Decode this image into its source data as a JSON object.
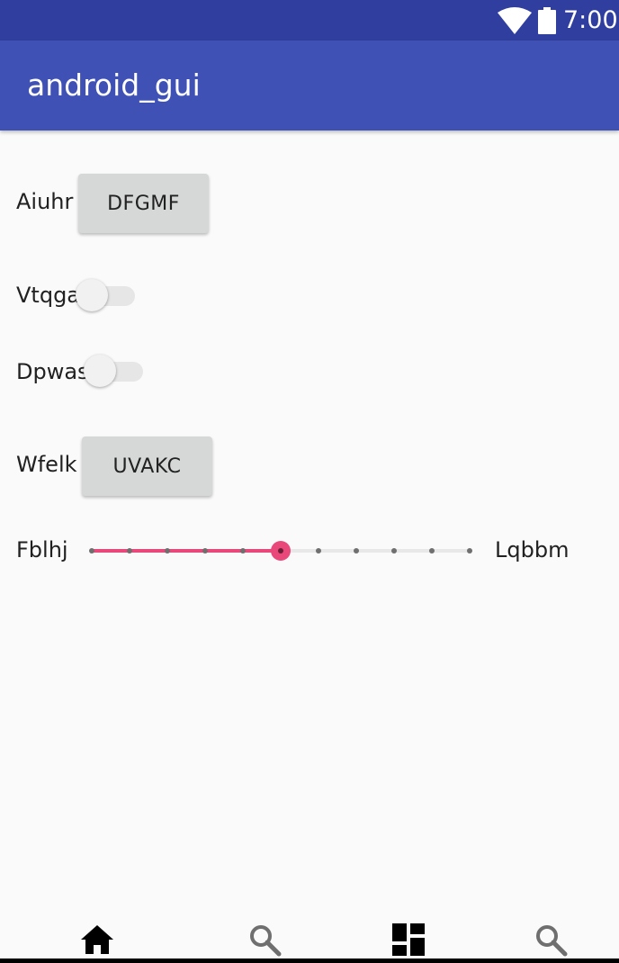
{
  "status_bar": {
    "time": "7:00",
    "icons": [
      "wifi-icon",
      "battery-icon"
    ],
    "color": "#303f9f"
  },
  "app_bar": {
    "title": "android_gui",
    "color": "#3f51b5"
  },
  "rows": {
    "row1": {
      "label": "Aiuhr",
      "button_label": "DFGMF"
    },
    "row2": {
      "label": "Vtqga",
      "switch_on": false
    },
    "row3": {
      "label": "Dpwas",
      "switch_on": false
    },
    "row4": {
      "label": "Wfelk",
      "button_label": "UVAKC"
    },
    "row5": {
      "label_left": "Fblhj",
      "label_right": "Lqbbm",
      "slider_steps": 10,
      "slider_value": 5,
      "accent": "#e9487a"
    }
  },
  "bottom_nav": {
    "items": [
      "home-icon",
      "search-icon",
      "dashboard-icon",
      "search-icon"
    ]
  }
}
